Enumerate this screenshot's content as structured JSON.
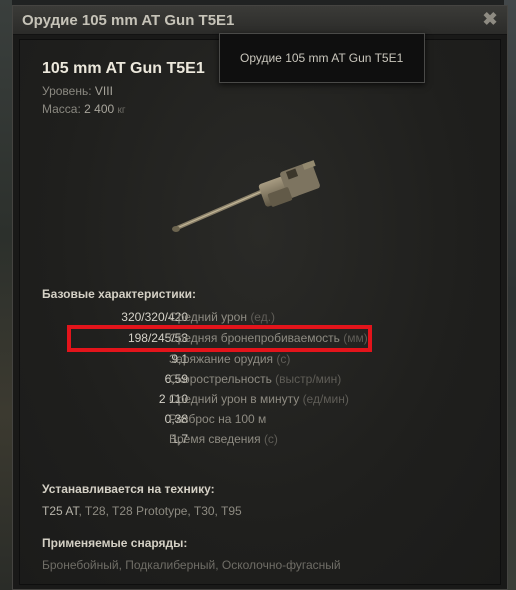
{
  "window": {
    "title": "Орудие 105 mm AT Gun T5E1",
    "close_glyph": "✖"
  },
  "tooltip": {
    "text": "Орудие 105 mm AT Gun T5E1"
  },
  "gun": {
    "name": "105 mm AT Gun T5E1",
    "tier_label": "Уровень:",
    "tier_value": "VIII",
    "mass_label": "Масса:",
    "mass_value": "2 400",
    "mass_unit": "кг"
  },
  "base_stats": {
    "title": "Базовые характеристики:",
    "rows": [
      {
        "value": "320/320/420",
        "name": "Средний урон",
        "unit": "(ед.)"
      },
      {
        "value": "198/245/53",
        "name": "Средняя бронепробиваемость",
        "unit": "(мм)",
        "highlighted": true
      },
      {
        "value": "9,1",
        "name": "Заряжание орудия",
        "unit": "(с)"
      },
      {
        "value": "6,59",
        "name": "Скорострельность",
        "unit": "(выстр/мин)"
      },
      {
        "value": "2 110",
        "name": "Средний урон в минуту",
        "unit": "(ед/мин)"
      },
      {
        "value": "0,38",
        "name": "Разброс на 100 м",
        "unit": ""
      },
      {
        "value": "1,7",
        "name": "Время сведения",
        "unit": "(с)"
      }
    ]
  },
  "vehicles": {
    "title": "Устанавливается на технику:",
    "current": "T25 AT",
    "others": ", T28, T28 Prototype, T30, T95"
  },
  "shells": {
    "title": "Применяемые снаряды:",
    "list": "Бронебойный, Подкалиберный, Осколочно-фугасный"
  },
  "colors": {
    "highlight": "#e3141b",
    "panel_bg": "#1f1f1d",
    "title_text": "#ece8dc"
  },
  "icons": {
    "close": "close-icon",
    "gun": "gun-icon"
  }
}
